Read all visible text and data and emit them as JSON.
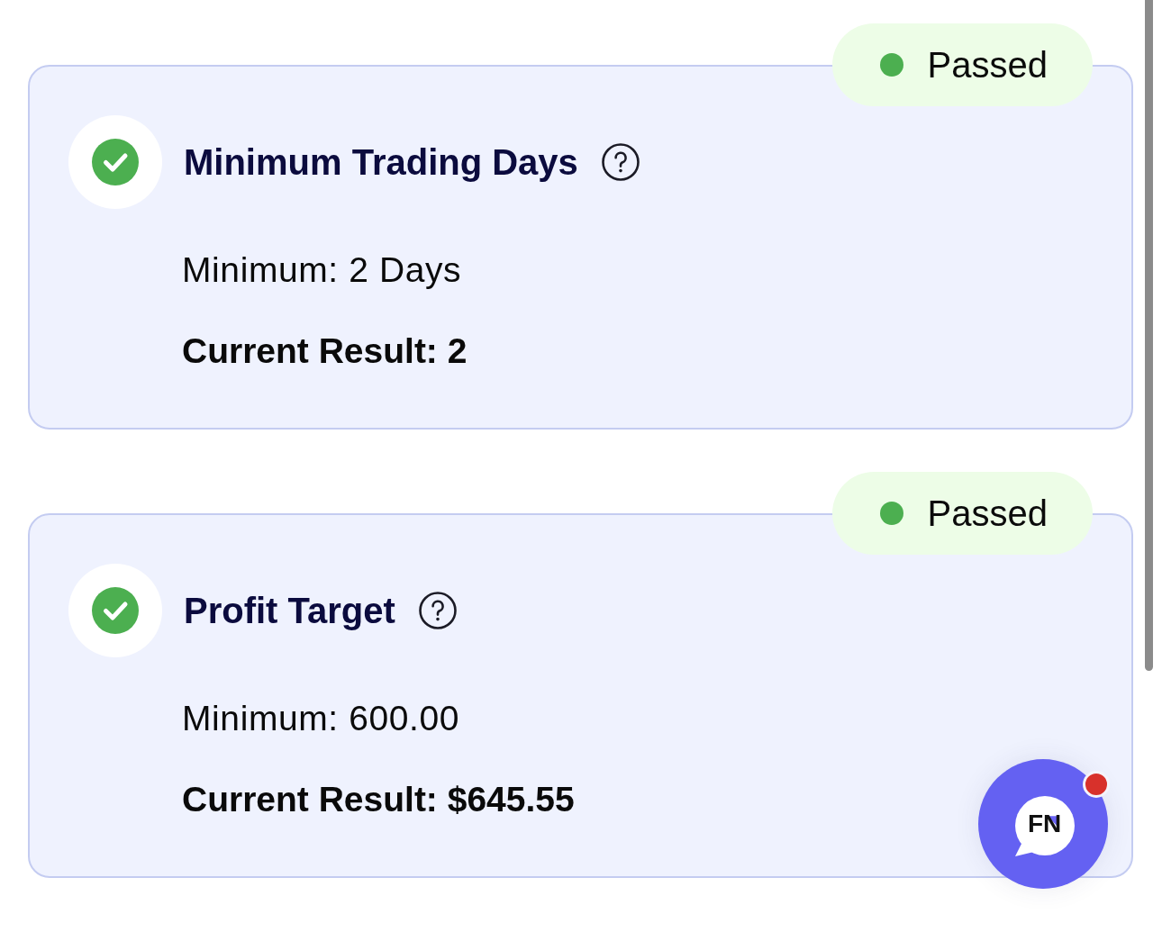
{
  "requirements": [
    {
      "title": "Minimum Trading Days",
      "passed": true,
      "status": "Passed",
      "minimum": "Minimum: 2 Days",
      "current_result": "Current Result: 2"
    },
    {
      "title": "Profit Target",
      "passed": true,
      "status": "Passed",
      "minimum": "Minimum: 600.00",
      "current_result": "Current Result: $645.55"
    }
  ],
  "chat_button": {
    "logo": "FN",
    "notification": true
  }
}
